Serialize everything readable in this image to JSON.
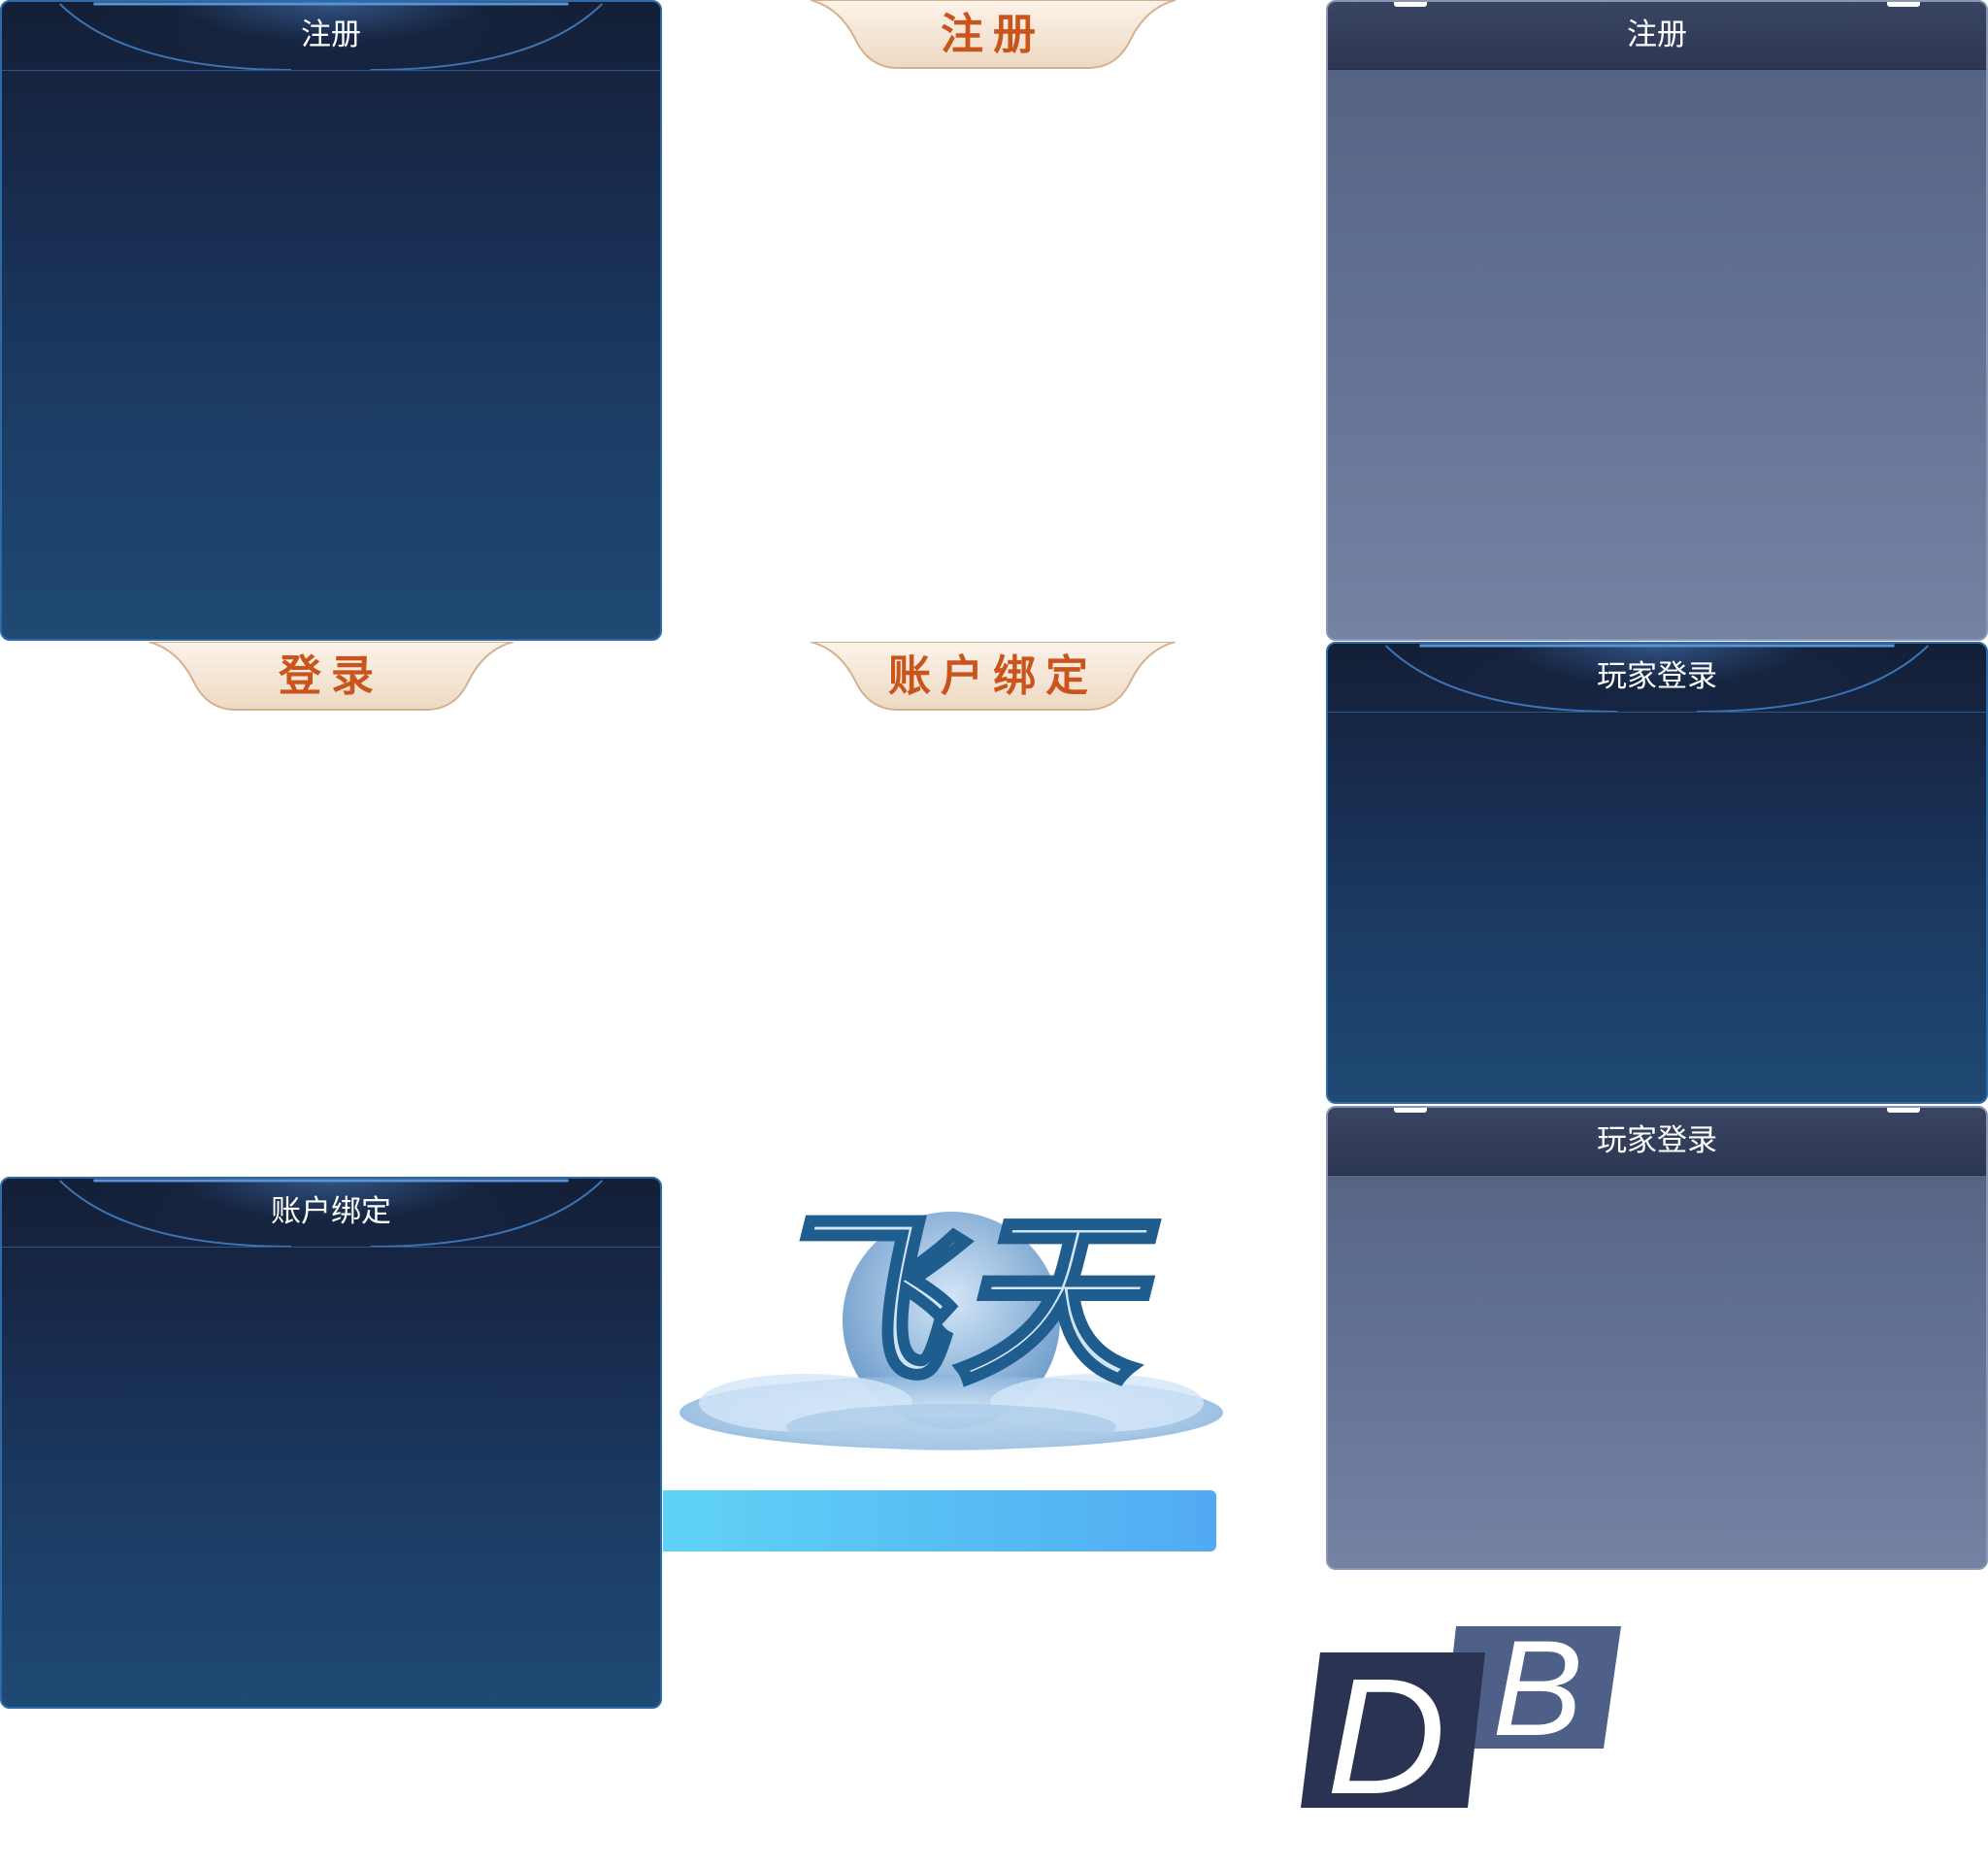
{
  "panels": {
    "register_dark": {
      "title": "注册"
    },
    "register_gray": {
      "title": "注册"
    },
    "player_login_dark": {
      "title": "玩家登录"
    },
    "player_login_gray": {
      "title": "玩家登录"
    },
    "account_bind_dark": {
      "title": "账户绑定"
    }
  },
  "tabs": {
    "register": {
      "label": "注册"
    },
    "login": {
      "label": "登录"
    },
    "account_bind": {
      "label": "账户绑定"
    }
  },
  "logo": {
    "text": "飞天"
  },
  "badge": {
    "letter1": "D",
    "letter2": "B"
  },
  "colors": {
    "panel_dark_top": "#141f36",
    "panel_dark_bottom": "#1f4a74",
    "panel_border_blue": "#2f6aa8",
    "panel_gray_top": "#515f80",
    "panel_gray_bottom": "#7482a4",
    "tab_text": "#c9541c",
    "tab_fill": "#f3e3d1",
    "bar_start": "#5fd3f6",
    "bar_end": "#52aaf2",
    "badge_dark": "#2a3452",
    "badge_light": "#4e5f88"
  }
}
